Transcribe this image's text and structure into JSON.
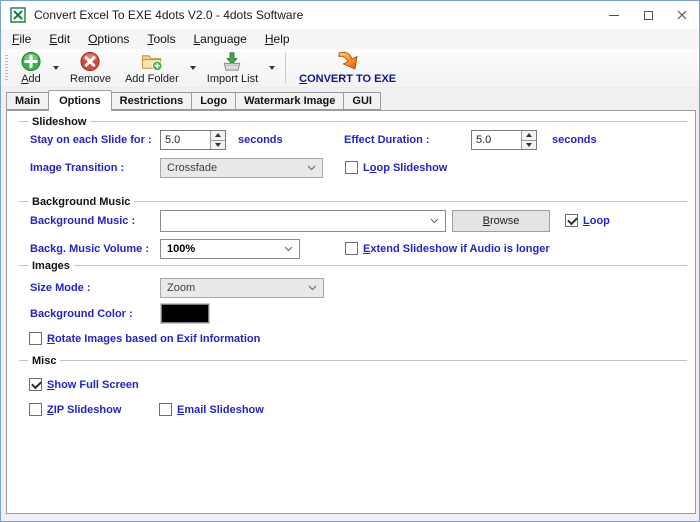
{
  "window": {
    "title": "Convert Excel To EXE 4dots V2.0 - 4dots Software"
  },
  "menu": {
    "items": [
      "File",
      "Edit",
      "Options",
      "Tools",
      "Language",
      "Help"
    ]
  },
  "toolbar": {
    "buttons": {
      "add": "Add",
      "remove": "Remove",
      "add_folder": "Add Folder",
      "import_list": "Import List",
      "convert": "CONVERT TO EXE"
    }
  },
  "tabs": {
    "items": [
      "Main",
      "Options",
      "Restrictions",
      "Logo",
      "Watermark Image",
      "GUI"
    ],
    "selected": "Options"
  },
  "slideshow": {
    "section_label": "Slideshow",
    "stay_label": "Stay on each Slide for :",
    "stay_value": "5.0",
    "stay_unit": "seconds",
    "effect_label": "Effect Duration :",
    "effect_value": "5.0",
    "effect_unit": "seconds",
    "transition_label": "Image Transition :",
    "transition_value": "Crossfade",
    "loop_slideshow_label": "Loop Slideshow",
    "loop_slideshow_checked": false
  },
  "background_music": {
    "section_label": "Background Music",
    "music_label": "Background Music :",
    "music_value": "",
    "browse_label": "Browse",
    "loop_label": "Loop",
    "loop_checked": true,
    "volume_label": "Backg. Music Volume :",
    "volume_value": "100%",
    "extend_label": "Extend Slideshow if Audio is longer",
    "extend_checked": false
  },
  "images": {
    "section_label": "Images",
    "size_mode_label": "Size Mode :",
    "size_mode_value": "Zoom",
    "bg_color_label": "Background Color :",
    "bg_color_value": "#000000",
    "rotate_label": "Rotate Images based on Exif Information",
    "rotate_checked": false
  },
  "misc": {
    "section_label": "Misc",
    "fullscreen_label": "Show Full Screen",
    "fullscreen_checked": true,
    "zip_label": "ZIP Slideshow",
    "zip_checked": false,
    "email_label": "Email Slideshow",
    "email_checked": false
  },
  "colors": {
    "label_blue": "#2323cb",
    "convert_label_navy": "#14148c",
    "background_color_swatch": "#000000"
  }
}
